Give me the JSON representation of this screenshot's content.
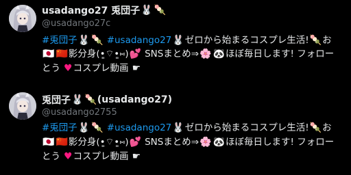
{
  "accounts": [
    {
      "display_name": "usadango27 兎団子",
      "display_name_emoji_1": "🐰",
      "display_name_emoji_2": "🍡",
      "display_name_suffix": "",
      "handle": "@usadango27c",
      "bio_line1": {
        "tag1": "#兎団子",
        "emoji1": "🐰",
        "emoji2": "🍡",
        "tag2": "#usadango27",
        "emoji3": "🐰",
        "text1": "ゼロから始まるコスプレ生活!",
        "emoji4": "🍡",
        "text2": "お"
      },
      "bio_line2": {
        "flag1": "🇯🇵",
        "flag2": "🇨🇳",
        "text1": "影分身(•͈⌔•͈⑅)",
        "emoji1": "💕",
        "text2": "SNSまとめ⇒",
        "emoji2": "🌸",
        "emoji3": "🐼",
        "text3": "ほぼ毎日します! フォロー"
      },
      "bio_line3": {
        "text1": "とう",
        "emoji1": "♥",
        "text2": "コスプレ動画",
        "emoji2": "☛"
      }
    },
    {
      "display_name": "兎団子",
      "display_name_emoji_1": "🐰",
      "display_name_emoji_2": "🍡",
      "display_name_suffix": "(usadango27)",
      "handle": "@usadango2755",
      "bio_line1": {
        "tag1": "#兎団子",
        "emoji1": "🐰",
        "emoji2": "🍡",
        "tag2": "#usadango27",
        "emoji3": "🐰",
        "text1": "ゼロから始まるコスプレ生活!",
        "emoji4": "🍡",
        "text2": "お"
      },
      "bio_line2": {
        "flag1": "🇯🇵",
        "flag2": "🇨🇳",
        "text1": "影分身(•͈⌔•͈⑅)",
        "emoji1": "💕",
        "text2": "SNSまとめ⇒",
        "emoji2": "🌸",
        "emoji3": "🐼",
        "text3": "ほぼ毎日します! フォロー"
      },
      "bio_line3": {
        "text1": "とう",
        "emoji1": "♥",
        "text2": "コスプレ動画",
        "emoji2": "☛"
      }
    }
  ],
  "colors": {
    "background": "#000000",
    "primary_text": "#e7e9ea",
    "secondary_text": "#71767b",
    "link": "#1d9bf0",
    "heart": "#f91880"
  }
}
